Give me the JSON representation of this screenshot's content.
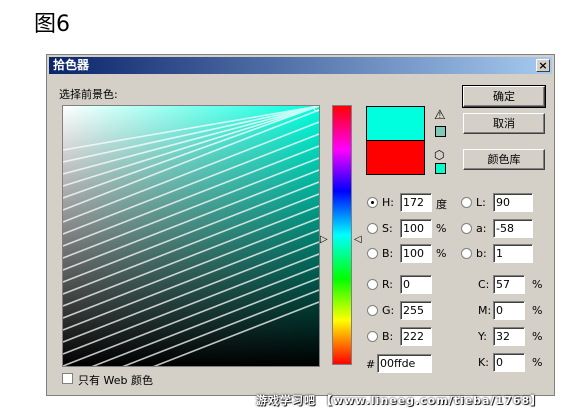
{
  "figure_label": "图6",
  "dialog": {
    "title": "拾色器",
    "close_label": "×",
    "prompt": "选择前景色:",
    "buttons": {
      "ok": "确定",
      "cancel": "取消",
      "libraries": "颜色库"
    },
    "web_only_label": "只有 Web 颜色",
    "hsb": [
      {
        "key": "H",
        "label": "H:",
        "value": "172",
        "unit": "度",
        "selected": true
      },
      {
        "key": "S",
        "label": "S:",
        "value": "100",
        "unit": "%",
        "selected": false
      },
      {
        "key": "B",
        "label": "B:",
        "value": "100",
        "unit": "%",
        "selected": false
      }
    ],
    "rgb": [
      {
        "key": "R",
        "label": "R:",
        "value": "0"
      },
      {
        "key": "G",
        "label": "G:",
        "value": "255"
      },
      {
        "key": "B",
        "label": "B:",
        "value": "222"
      }
    ],
    "lab": [
      {
        "key": "L",
        "label": "L:",
        "value": "90"
      },
      {
        "key": "a",
        "label": "a:",
        "value": "-58"
      },
      {
        "key": "b",
        "label": "b:",
        "value": "1"
      }
    ],
    "cmyk": [
      {
        "key": "C",
        "label": "C:",
        "value": "57",
        "unit": "%"
      },
      {
        "key": "M",
        "label": "M:",
        "value": "0",
        "unit": "%"
      },
      {
        "key": "Y",
        "label": "Y:",
        "value": "32",
        "unit": "%"
      },
      {
        "key": "K",
        "label": "K:",
        "value": "0",
        "unit": "%"
      }
    ],
    "hex_label": "#",
    "hex_value": "00ffde",
    "colors": {
      "new_color": "#00ffde",
      "current_color": "#ff0000",
      "gamut_swatch": "#80c8b8",
      "web_swatch": "#00ffcc",
      "field_hue": "#00ffde"
    }
  },
  "watermark": "游戏学习吧 【www.lineeg.com/tieba/1768】"
}
